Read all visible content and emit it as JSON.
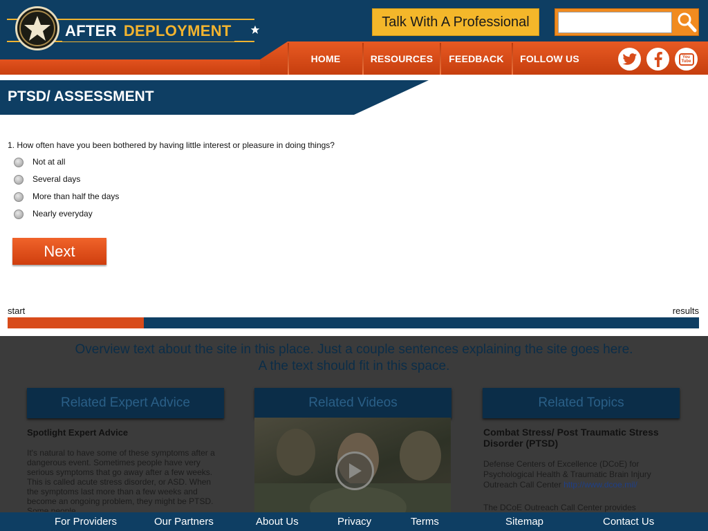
{
  "header": {
    "logo_word_1": "AFTER",
    "logo_word_2": "DEPLOYMENT",
    "talk_button": "Talk With A Professional",
    "search": {
      "value": "",
      "placeholder": ""
    },
    "nav": [
      "HOME",
      "RESOURCES",
      "FEEDBACK",
      "FOLLOW US"
    ],
    "social": [
      "twitter-icon",
      "facebook-icon",
      "youtube-icon"
    ],
    "youtube_text": "You Tube"
  },
  "page": {
    "title": "PTSD/ ASSESSMENT"
  },
  "assessment": {
    "question": "1. How often have you been bothered by having little interest or pleasure in doing things?",
    "options": [
      "Not at all",
      "Several days",
      "More than half the days",
      "Nearly everyday"
    ],
    "selected": null,
    "next_label": "Next"
  },
  "progress": {
    "start_label": "start",
    "end_label": "results",
    "fraction": 0.197
  },
  "footer": {
    "overview_line1": "Overview text about the site in this place. Just a couple sentences explaining the site goes here.",
    "overview_line2": "A the text should fit in this space.",
    "columns": {
      "expert": {
        "heading": "Related Expert Advice",
        "title": "Spotlight Expert Advice",
        "body": "It's natural to have some of these symptoms after a dangerous event. Sometimes people have very serious symptoms that go away after a few weeks. This is called acute stress disorder, or ASD. When the symptoms last more than a few weeks and become an ongoing problem, they might be PTSD. Some people"
      },
      "videos": {
        "heading": "Related Videos"
      },
      "topics": {
        "heading": "Related Topics",
        "title": "Combat Stress/ Post Traumatic Stress Disorder (PTSD)",
        "body1": "Defense Centers of Excellence (DCoE) for Psychological Health & Traumatic Brain Injury Outreach Call Center",
        "link": "http://www.dcoe.mil/",
        "body2": "The DCoE Outreach Call Center provides"
      }
    },
    "links": [
      "For Providers",
      "Our Partners",
      "About Us",
      "Privacy",
      "Terms",
      "Sitemap",
      "Contact Us"
    ]
  },
  "colors": {
    "navy": "#0e3e63",
    "orange": "#d84b1a",
    "gold": "#f4b72a"
  }
}
